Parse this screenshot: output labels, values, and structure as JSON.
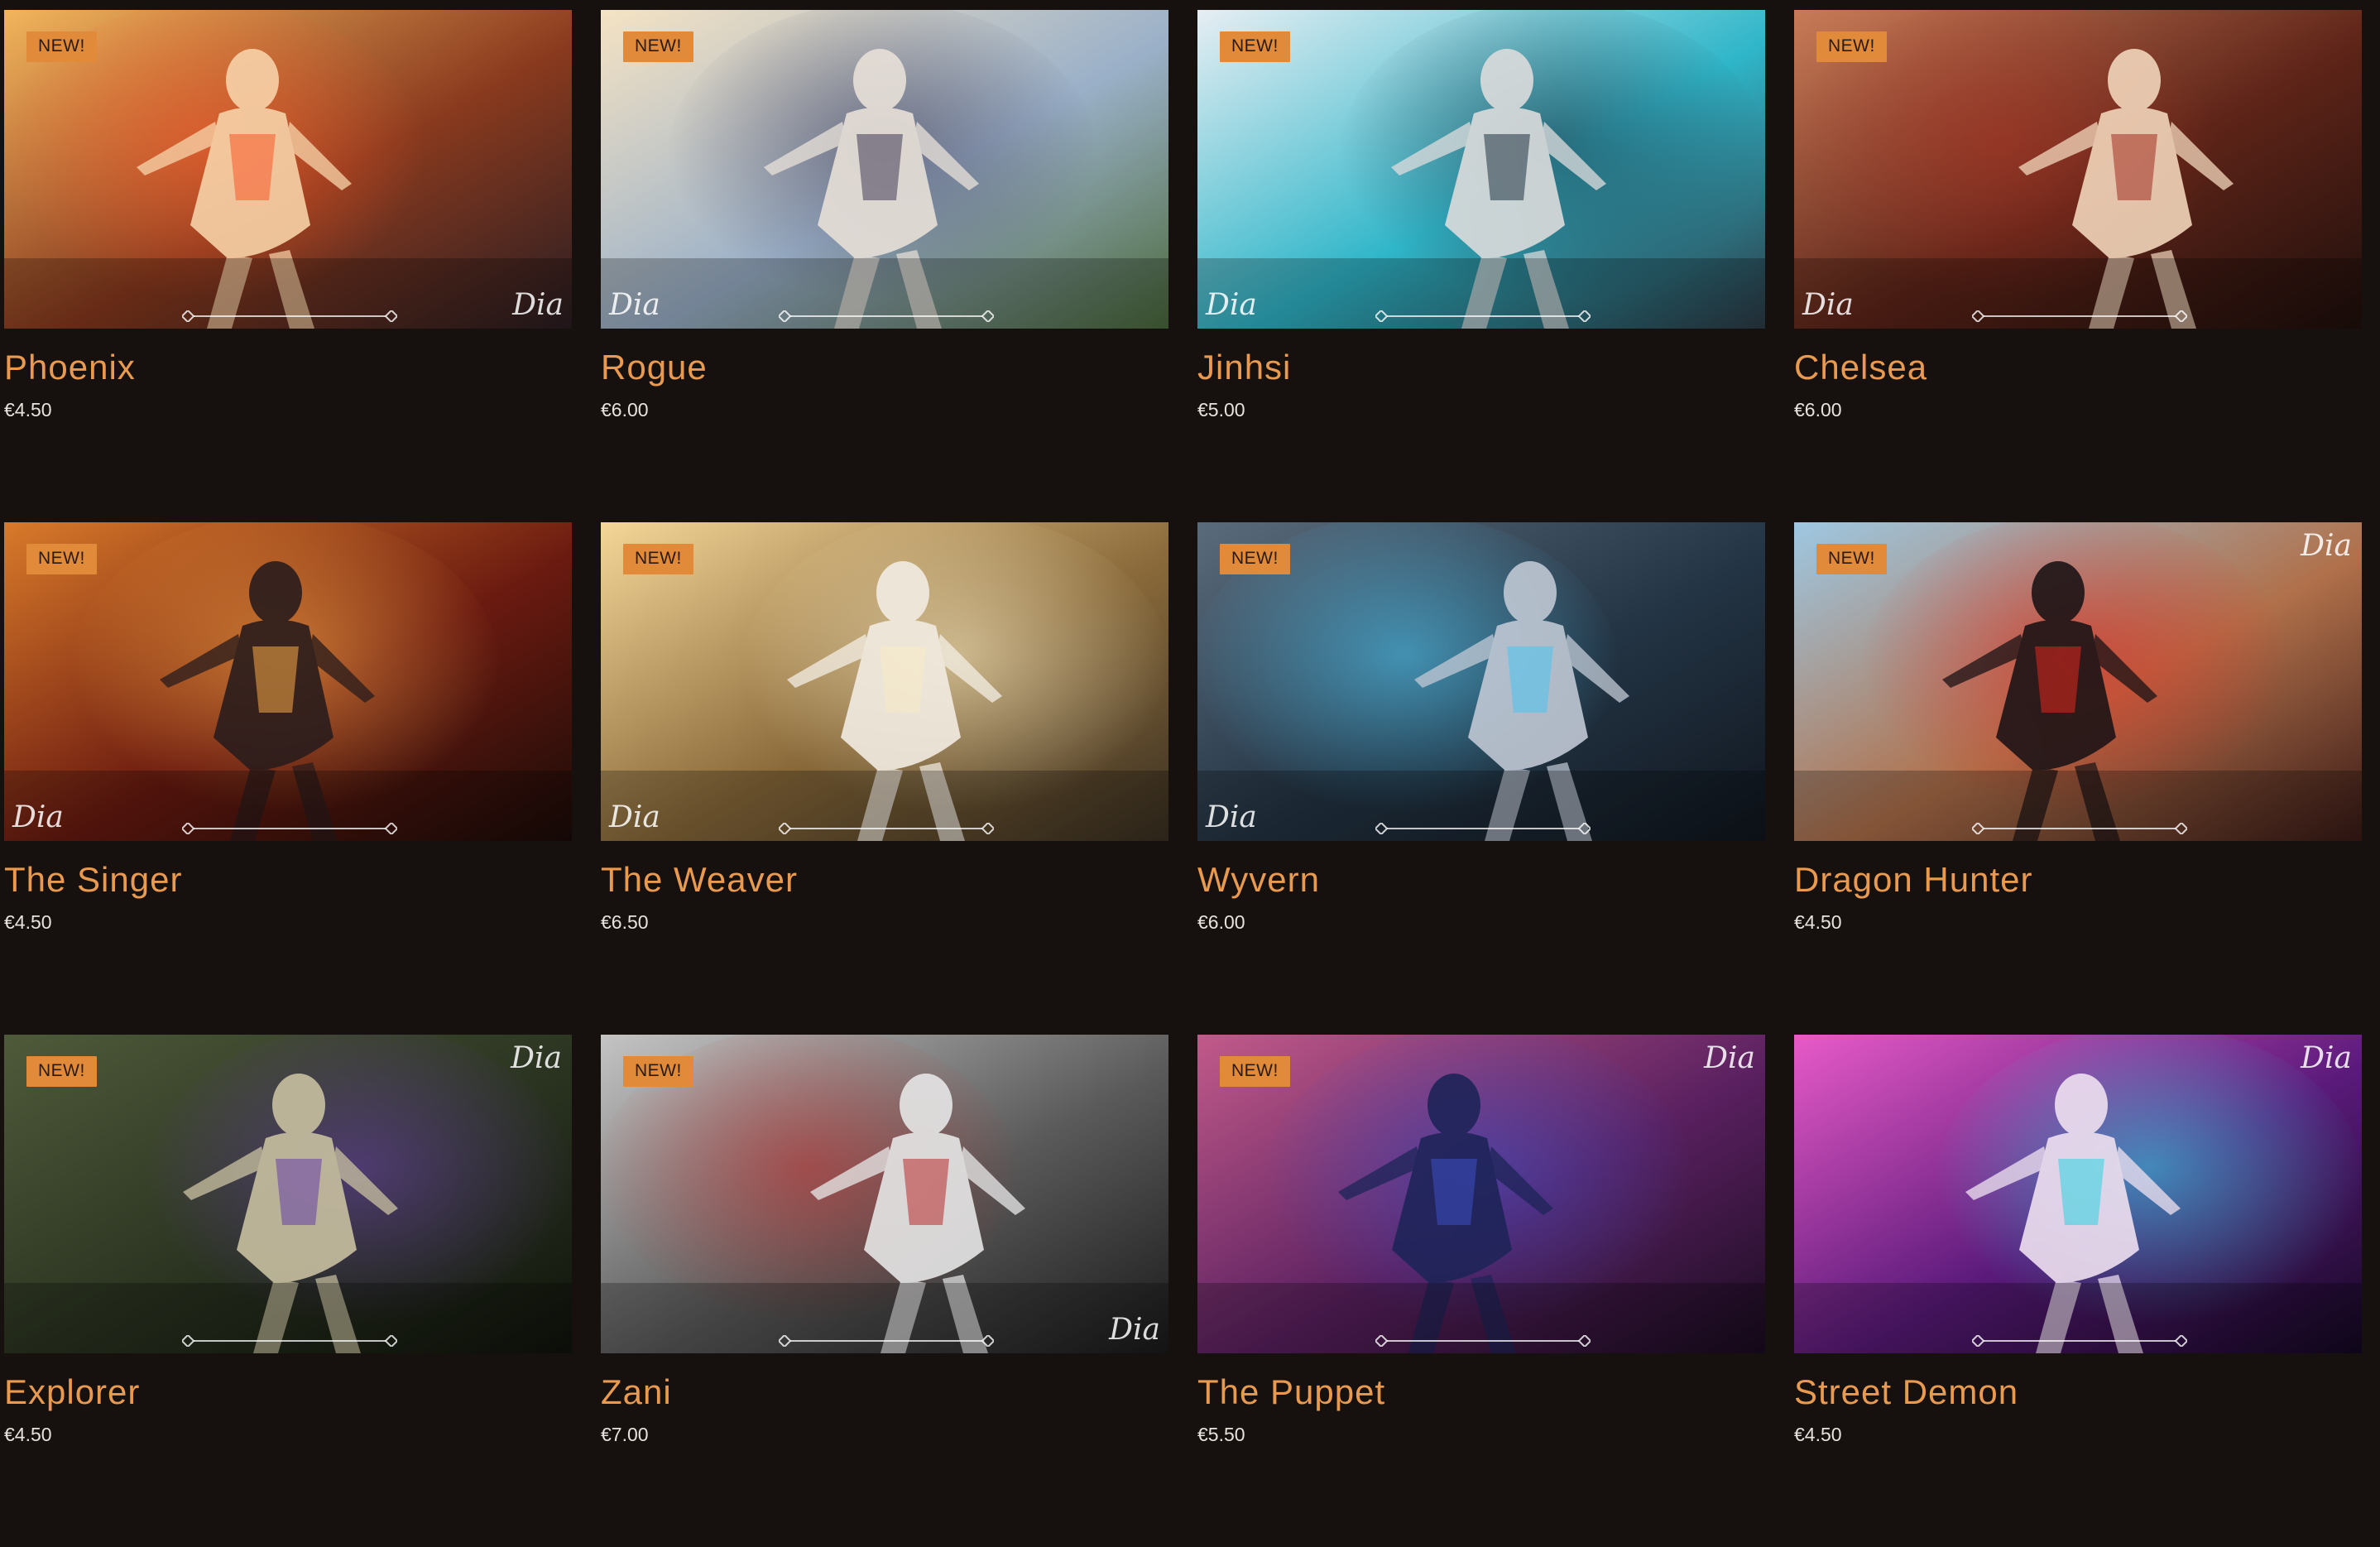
{
  "products": [
    {
      "title": "Phoenix",
      "price": "€4.50",
      "badge": "NEW!",
      "sig": "Dia",
      "c1": "#f2b55c",
      "c2": "#8a3a1e",
      "c3": "#2a1d22",
      "accent": "#ff5a2a",
      "figure": "#f7d2a8"
    },
    {
      "title": "Rogue",
      "price": "€6.00",
      "badge": "NEW!",
      "sig": "Dia",
      "c1": "#f5e3c4",
      "c2": "#9ab0c8",
      "c3": "#4b6a3c",
      "accent": "#3a3550",
      "figure": "#e8e0d8"
    },
    {
      "title": "Jinhsi",
      "price": "€5.00",
      "badge": "NEW!",
      "sig": "Dia",
      "c1": "#e7eef3",
      "c2": "#2fb6c9",
      "c3": "#2c3b46",
      "accent": "#1f2c3a",
      "figure": "#dcdcdc"
    },
    {
      "title": "Chelsea",
      "price": "€6.00",
      "badge": "NEW!",
      "sig": "Dia",
      "c1": "#c97b57",
      "c2": "#5e2418",
      "c3": "#1f0f0c",
      "accent": "#a83022",
      "figure": "#f1d5ba"
    },
    {
      "title": "The Singer",
      "price": "€4.50",
      "badge": "NEW!",
      "sig": "Dia",
      "c1": "#d97a2a",
      "c2": "#6b1a10",
      "c3": "#1a0b08",
      "accent": "#ffb04a",
      "figure": "#2a1c1c"
    },
    {
      "title": "The Weaver",
      "price": "€6.50",
      "badge": "NEW!",
      "sig": "Dia",
      "c1": "#f5d698",
      "c2": "#8a6a3a",
      "c3": "#3a3022",
      "accent": "#fff4d0",
      "figure": "#f2ece2"
    },
    {
      "title": "Wyvern",
      "price": "€6.00",
      "badge": "NEW!",
      "sig": "Dia",
      "c1": "#5a6b7c",
      "c2": "#233444",
      "c3": "#10161e",
      "accent": "#4fd0ff",
      "figure": "#c0c8d4"
    },
    {
      "title": "Dragon Hunter",
      "price": "€4.50",
      "badge": "NEW!",
      "sig": "Dia",
      "c1": "#9ec8e3",
      "c2": "#b0704a",
      "c3": "#3a1a16",
      "accent": "#e3221c",
      "figure": "#1d1416"
    },
    {
      "title": "Explorer",
      "price": "€4.50",
      "badge": "NEW!",
      "sig": "Dia",
      "c1": "#4f5a3a",
      "c2": "#2a3320",
      "c3": "#10140c",
      "accent": "#6a3fb0",
      "figure": "#c8c0a0"
    },
    {
      "title": "Zani",
      "price": "€7.00",
      "badge": "NEW!",
      "sig": "Dia",
      "c1": "#c4c4c4",
      "c2": "#5a5a5a",
      "c3": "#1a1a1a",
      "accent": "#c02828",
      "figure": "#e6e6e6"
    },
    {
      "title": "The Puppet",
      "price": "€5.50",
      "badge": "NEW!",
      "sig": "Dia",
      "c1": "#c25a8a",
      "c2": "#5a2060",
      "c3": "#1a0c20",
      "accent": "#3a50c8",
      "figure": "#1e2458"
    },
    {
      "title": "Street Demon",
      "price": "€4.50",
      "badge": null,
      "sig": "Dia",
      "c1": "#e85ac8",
      "c2": "#5a1a7a",
      "c3": "#140822",
      "accent": "#2ae0e8",
      "figure": "#efe0f0"
    }
  ]
}
